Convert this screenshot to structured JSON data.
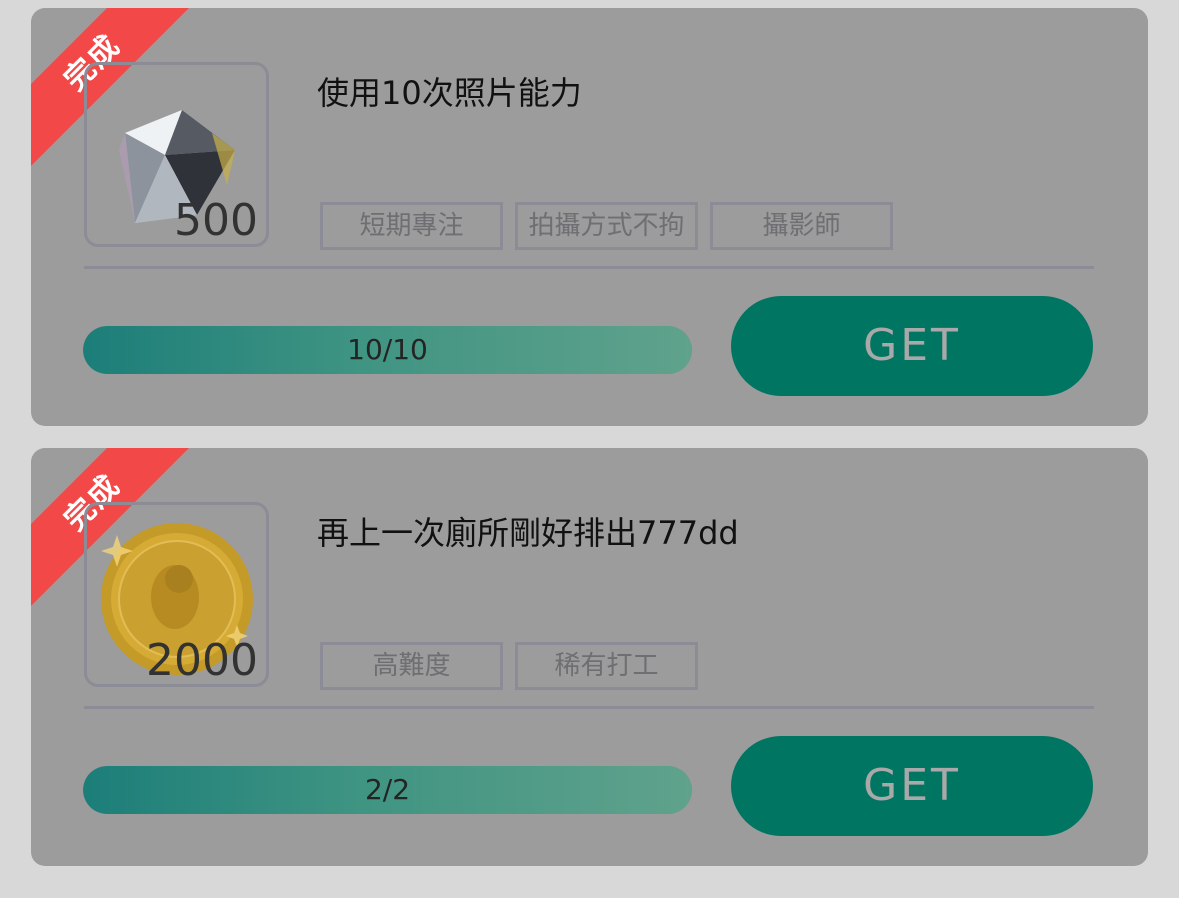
{
  "colors": {
    "page_background": "#d8d8d8",
    "card_background": "#9c9c9c",
    "ribbon": "#f34848",
    "button": "#007562",
    "progress_start": "#1c7e79",
    "progress_end": "#60a28c"
  },
  "tasks": [
    {
      "status_label": "完成",
      "reward_icon": "diamond-icon",
      "reward_amount": "500",
      "title": "使用10次照片能力",
      "tags": [
        "短期專注",
        "拍攝方式不拘",
        "攝影師"
      ],
      "progress_label": "10/10",
      "progress_fraction": 1.0,
      "button_label": "GET"
    },
    {
      "status_label": "完成",
      "reward_icon": "gold-coin-icon",
      "reward_amount": "2000",
      "title": "再上一次廁所剛好排出777dd",
      "tags": [
        "高難度",
        "稀有打工"
      ],
      "progress_label": "2/2",
      "progress_fraction": 1.0,
      "button_label": "GET"
    }
  ]
}
